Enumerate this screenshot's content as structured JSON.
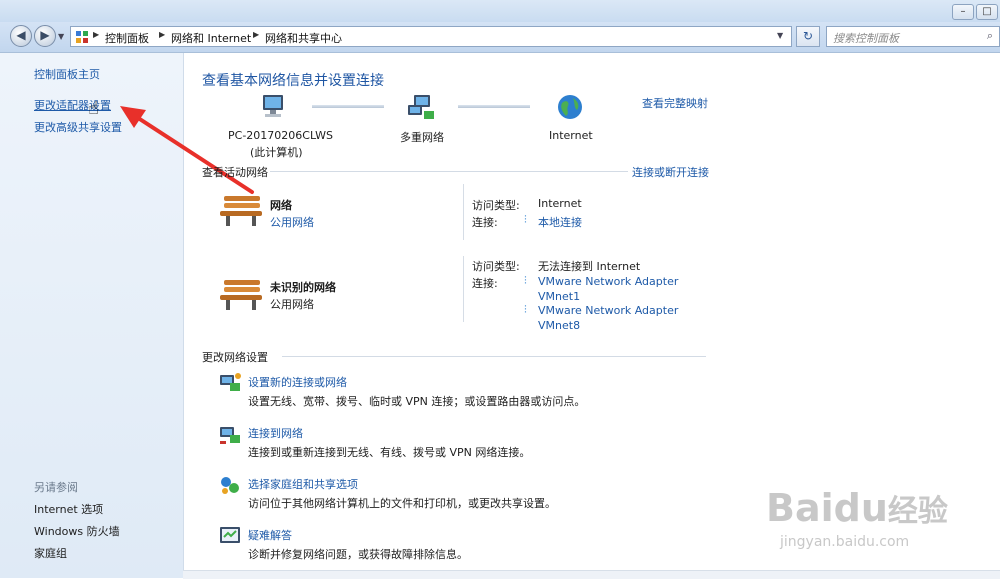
{
  "titlebar": {
    "minimize": "–",
    "maximize": "□"
  },
  "nav": {
    "back": "◀",
    "forward": "▶",
    "breadcrumb": [
      "控制面板",
      "网络和 Internet",
      "网络和共享中心"
    ],
    "refresh": "↻",
    "search_placeholder": "搜索控制面板"
  },
  "sidebar": {
    "home": "控制面板主页",
    "items": [
      "更改适配器设置",
      "更改高级共享设置"
    ],
    "see_also_title": "另请参阅",
    "see_also": [
      "Internet 选项",
      "Windows 防火墙",
      "家庭组"
    ]
  },
  "main": {
    "title": "查看基本网络信息并设置连接",
    "view_full_map": "查看完整映射",
    "map_nodes": [
      {
        "label": "PC-20170206CLWS",
        "sublabel": "(此计算机)"
      },
      {
        "label": "多重网络",
        "sublabel": ""
      },
      {
        "label": "Internet",
        "sublabel": ""
      }
    ],
    "active_networks_title": "查看活动网络",
    "connect_disconnect": "连接或断开连接",
    "networks": [
      {
        "name": "网络",
        "type": "公用网络",
        "access_label": "访问类型:",
        "access_value": "Internet",
        "conn_label": "连接:",
        "connections": [
          "本地连接"
        ]
      },
      {
        "name": "未识别的网络",
        "type": "公用网络",
        "access_label": "访问类型:",
        "access_value": "无法连接到 Internet",
        "conn_label": "连接:",
        "connections": [
          "VMware Network Adapter",
          "VMnet1",
          "VMware Network Adapter",
          "VMnet8"
        ]
      }
    ],
    "change_settings_title": "更改网络设置",
    "tasks": [
      {
        "link": "设置新的连接或网络",
        "desc": "设置无线、宽带、拨号、临时或 VPN 连接；或设置路由器或访问点。"
      },
      {
        "link": "连接到网络",
        "desc": "连接到或重新连接到无线、有线、拨号或 VPN 网络连接。"
      },
      {
        "link": "选择家庭组和共享选项",
        "desc": "访问位于其他网络计算机上的文件和打印机，或更改共享设置。"
      },
      {
        "link": "疑难解答",
        "desc": "诊断并修复网络问题，或获得故障排除信息。"
      }
    ]
  },
  "watermark": {
    "brand": "Bai",
    "brand2": "du",
    "brand3": "经验",
    "url": "jingyan.baidu.com"
  },
  "colors": {
    "link": "#1e5aa8",
    "title": "#1f56a3",
    "annotation_arrow": "#e8302a"
  }
}
